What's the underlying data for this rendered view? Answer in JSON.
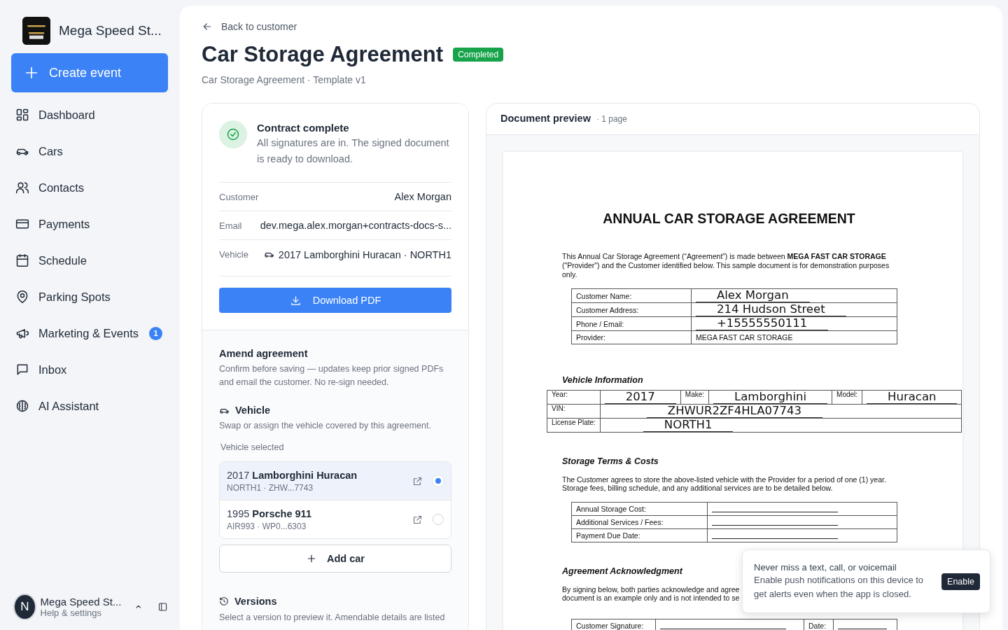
{
  "sidebar": {
    "brand": "Mega Speed St...",
    "create_button": "Create event",
    "nav": [
      {
        "label": "Dashboard",
        "selected": false
      },
      {
        "label": "Cars",
        "selected": false
      },
      {
        "label": "Contacts",
        "selected": false
      },
      {
        "label": "Payments",
        "selected": false
      },
      {
        "label": "Schedule",
        "selected": false
      },
      {
        "label": "Parking Spots",
        "selected": false
      },
      {
        "label": "Marketing & Events",
        "selected": false,
        "badge": "1"
      },
      {
        "label": "Inbox",
        "selected": false
      },
      {
        "label": "AI Assistant",
        "selected": false
      }
    ],
    "account": {
      "avatar": "N",
      "name": "Mega Speed St...",
      "subtitle": "Help & settings"
    }
  },
  "header": {
    "back_link": "Back to customer",
    "title": "Car Storage Agreement",
    "status": "Completed",
    "subtitle": "Car Storage Agreement · Template v1"
  },
  "summary": {
    "title": "Contract complete",
    "text": "All signatures are in. The signed document is ready to download.",
    "fields": [
      {
        "label": "Customer",
        "value": "Alex Morgan"
      },
      {
        "label": "Email",
        "value": "dev.mega.alex.morgan+contracts-docs-s..."
      },
      {
        "label": "Vehicle",
        "value": "2017 Lamborghini Huracan · NORTH1"
      }
    ],
    "download_button": "Download PDF"
  },
  "amend": {
    "title": "Amend agreement",
    "text": "Confirm before saving — updates keep prior signed PDFs and email the customer. No re-sign needed.",
    "vehicle": {
      "title": "Vehicle",
      "text": "Swap or assign the vehicle covered by this agreement.",
      "label": "Vehicle selected",
      "options": [
        {
          "name": "2017 **Lamborghini Huracan**",
          "detail": "NORTH1 · ZHW...7743",
          "selected": true
        },
        {
          "name": "1995 **Porsche 911**",
          "detail": "AIR993 · WP0...6303",
          "selected": false
        }
      ],
      "add_button": "Add car"
    },
    "versions": {
      "title": "Versions",
      "text": "Select a version to preview it. Amendable details are listed"
    }
  },
  "preview": {
    "title": "Document preview",
    "pages": "· 1 page",
    "document": {
      "heading": "ANNUAL CAR STORAGE AGREEMENT",
      "intro": "This Annual Car Storage Agreement (“Agreement”) is made between **MEGA FAST CAR STORAGE** (\"Provider\") and the Customer identified below. This sample document is for demonstration purposes only.",
      "parties": [
        {
          "label": "Customer Name:",
          "value": "Alex Morgan",
          "kind": "filled"
        },
        {
          "label": "Customer Address:",
          "value": "214 Hudson Street",
          "kind": "filled"
        },
        {
          "label": "Phone / Email:",
          "value": "+15555550111",
          "kind": "filled"
        },
        {
          "label": "Provider:",
          "value": "MEGA FAST CAR STORAGE",
          "kind": "printed"
        }
      ],
      "vehicle_heading": "Vehicle Information",
      "vehicle": {
        "year_label": "Year:",
        "year": "2017",
        "make_label": "Make:",
        "make": "Lamborghini",
        "model_label": "Model:",
        "model": "Huracan",
        "vin_label": "VIN:",
        "vin": "ZHWUR2ZF4HLA07743",
        "plate_label": "License Plate:",
        "plate": "NORTH1"
      },
      "terms_heading": "Storage Terms & Costs",
      "terms_text": "The Customer agrees to store the above-listed vehicle with the Provider for a period of one (1) year. Storage fees, billing schedule, and any additional services are to be detailed below.",
      "terms_rows": [
        "Annual Storage Cost:",
        "Additional Services / Fees:",
        "Payment Due Date:"
      ],
      "ack_heading": "Agreement Acknowledgment",
      "ack_lines": [
        "By signing below, both parties acknowledge and agree",
        "document is an example only and is not intended to se"
      ],
      "signature_label": "Customer Signature:",
      "date_label": "Date:"
    }
  },
  "toast": {
    "title": "Never miss a text, call, or voicemail",
    "text": "Enable push notifications on this device to get alerts even when the app is closed.",
    "button": "Enable"
  }
}
